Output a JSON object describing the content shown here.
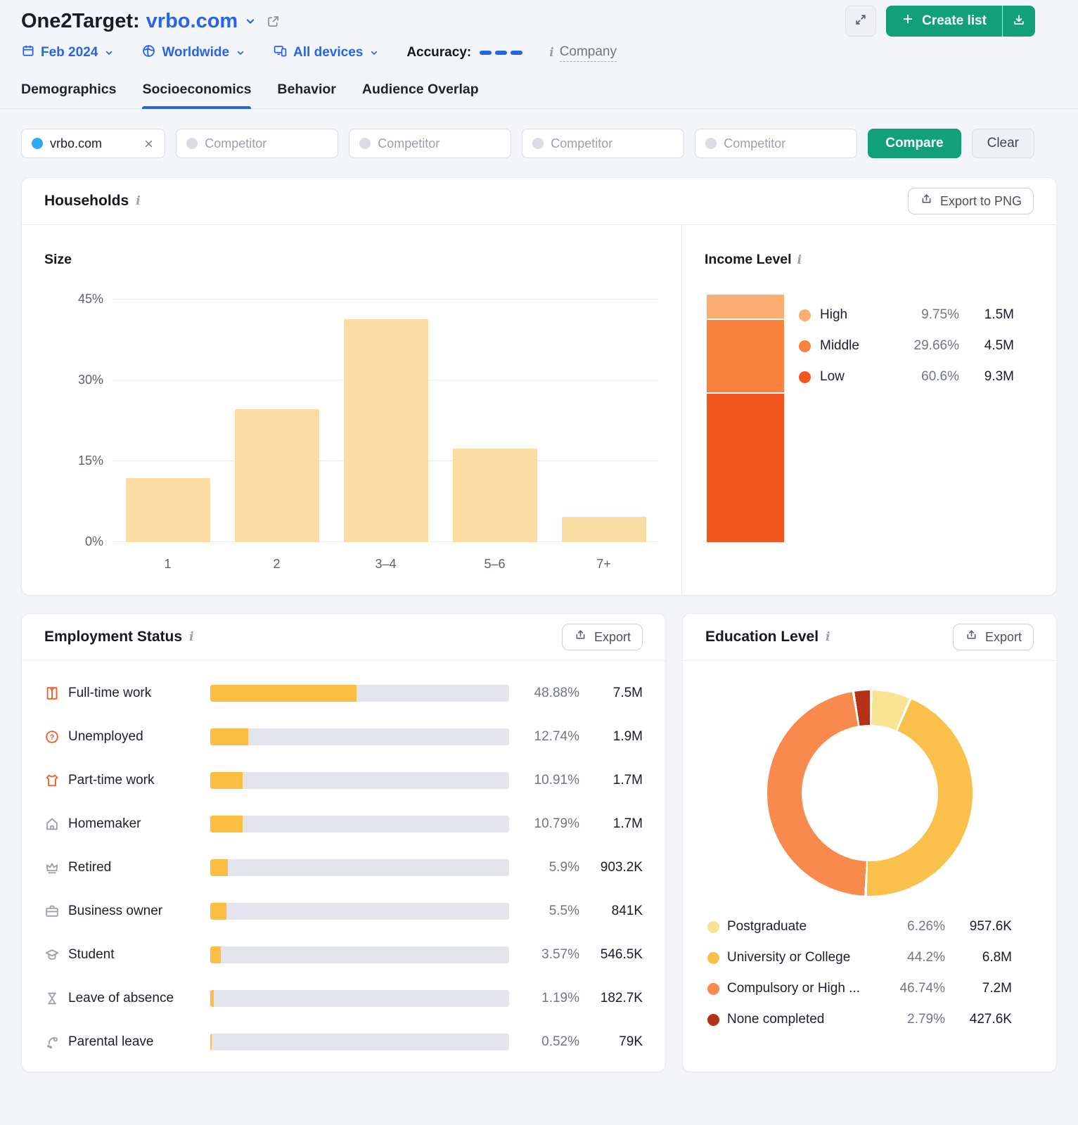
{
  "page": {
    "background": "#f4f5f8",
    "accent_blue": "#2765e8",
    "accent_green": "#11a077"
  },
  "header": {
    "title_prefix": "One2Target:",
    "domain": "vrbo.com",
    "create_list_label": "Create list",
    "filters": {
      "date": "Feb 2024",
      "region": "Worldwide",
      "devices": "All devices",
      "accuracy_label": "Accuracy:",
      "company_label": "Company"
    },
    "tabs": [
      {
        "label": "Demographics",
        "active": false
      },
      {
        "label": "Socioeconomics",
        "active": true
      },
      {
        "label": "Behavior",
        "active": false
      },
      {
        "label": "Audience Overlap",
        "active": false
      }
    ]
  },
  "compare": {
    "selected_domain": "vrbo.com",
    "selected_dot_color": "#2fa9f4",
    "competitor_dot_color": "#dadce3",
    "competitor_placeholder": "Competitor",
    "compare_label": "Compare",
    "clear_label": "Clear"
  },
  "cards": {
    "households": {
      "title": "Households",
      "export_label": "Export to PNG"
    },
    "employment": {
      "export_label": "Export"
    },
    "education": {
      "export_label": "Export"
    }
  },
  "chart_data": [
    {
      "id": "household_size",
      "type": "bar",
      "title": "Size",
      "categories": [
        "1",
        "2",
        "3–4",
        "5–6",
        "7+"
      ],
      "values": [
        11.9,
        24.6,
        41.4,
        17.4,
        4.7
      ],
      "unit": "%",
      "ylim": [
        0,
        45
      ],
      "yticks": [
        0,
        15,
        30,
        45
      ],
      "bar_color": "#fbdca3",
      "grid": true,
      "legend": "none"
    },
    {
      "id": "income_level",
      "type": "bar",
      "subtype": "stacked-vertical",
      "title": "Income Level",
      "categories": [
        "High",
        "Middle",
        "Low"
      ],
      "values": [
        9.75,
        29.66,
        60.6
      ],
      "counts": [
        "1.5M",
        "4.5M",
        "9.3M"
      ],
      "colors": [
        "#fbae71",
        "#f9823f",
        "#f4561f"
      ],
      "legend_position": "right"
    },
    {
      "id": "employment_status",
      "type": "bar",
      "subtype": "horizontal-progress",
      "title": "Employment Status",
      "categories": [
        "Full-time work",
        "Unemployed",
        "Part-time work",
        "Homemaker",
        "Retired",
        "Business owner",
        "Student",
        "Leave of absence",
        "Parental leave"
      ],
      "values": [
        48.88,
        12.74,
        10.91,
        10.79,
        5.9,
        5.5,
        3.57,
        1.19,
        0.52
      ],
      "counts": [
        "7.5M",
        "1.9M",
        "1.7M",
        "1.7M",
        "903.2K",
        "841K",
        "546.5K",
        "182.7K",
        "79K"
      ],
      "icons": [
        "suit-icon",
        "question-icon",
        "tshirt-icon",
        "home-icon",
        "crown-icon",
        "briefcase-icon",
        "graduation-cap-icon",
        "hourglass-icon",
        "pacifier-icon"
      ],
      "icon_colors": [
        "#f75a28",
        "#f75a28",
        "#f75a28",
        "#9aa1ad",
        "#9aa1ad",
        "#9aa1ad",
        "#9aa1ad",
        "#9aa1ad",
        "#9aa1ad"
      ],
      "bar_color": "#fcbe42",
      "track_color": "#e4e4ec",
      "xlim": [
        0,
        100
      ]
    },
    {
      "id": "education_level",
      "type": "pie",
      "subtype": "donut",
      "title": "Education Level",
      "categories": [
        "Postgraduate",
        "University or College",
        "Compulsory or High ...",
        "None completed"
      ],
      "values": [
        6.26,
        44.2,
        46.74,
        2.79
      ],
      "counts": [
        "957.6K",
        "6.8M",
        "7.2M",
        "427.6K"
      ],
      "colors": [
        "#f7e392",
        "#f9c14b",
        "#f98a4d",
        "#b53218"
      ],
      "legend_position": "bottom"
    }
  ]
}
